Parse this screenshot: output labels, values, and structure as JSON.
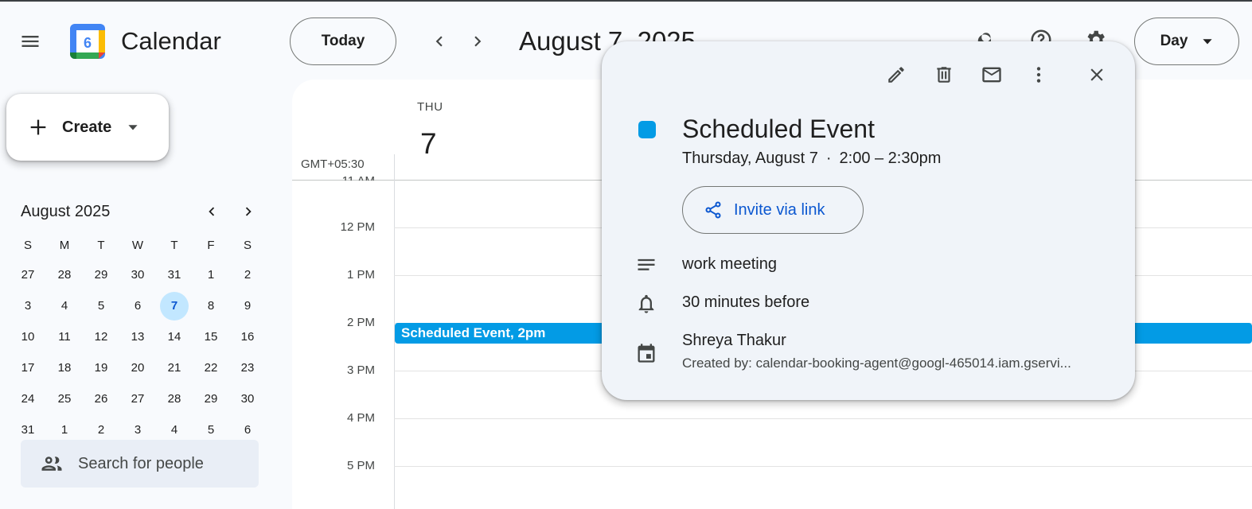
{
  "app": {
    "title": "Calendar",
    "logo_day": "6"
  },
  "header": {
    "today_label": "Today",
    "date_title": "August 7, 2025",
    "view_label": "Day"
  },
  "create": {
    "label": "Create"
  },
  "mini_calendar": {
    "title": "August 2025",
    "dows": [
      "S",
      "M",
      "T",
      "W",
      "T",
      "F",
      "S"
    ],
    "weeks": [
      [
        "27",
        "28",
        "29",
        "30",
        "31",
        "1",
        "2"
      ],
      [
        "3",
        "4",
        "5",
        "6",
        "7",
        "8",
        "9"
      ],
      [
        "10",
        "11",
        "12",
        "13",
        "14",
        "15",
        "16"
      ],
      [
        "17",
        "18",
        "19",
        "20",
        "21",
        "22",
        "23"
      ],
      [
        "24",
        "25",
        "26",
        "27",
        "28",
        "29",
        "30"
      ],
      [
        "31",
        "1",
        "2",
        "3",
        "4",
        "5",
        "6"
      ]
    ],
    "selected": "7"
  },
  "people_search": {
    "placeholder": "Search for people"
  },
  "day_view": {
    "dow": "THU",
    "day": "7",
    "timezone": "GMT+05:30",
    "partial_hour_label": "11 AM",
    "hours": [
      "12 PM",
      "1 PM",
      "2 PM",
      "3 PM",
      "4 PM",
      "5 PM"
    ]
  },
  "event": {
    "title": "Scheduled Event,",
    "time": "2pm"
  },
  "popover": {
    "title": "Scheduled Event",
    "date": "Thursday, August 7",
    "separator": "·",
    "time": "2:00 – 2:30pm",
    "invite_label": "Invite via link",
    "description": "work meeting",
    "reminder": "30 minutes before",
    "calendar_owner": "Shreya Thakur",
    "created_by": "Created by: calendar-booking-agent@googl-465014.iam.gservi..."
  },
  "colors": {
    "event": "#039be5",
    "accent": "#0b57d0",
    "today_highlight": "#c2e7ff",
    "background": "#f8fafd",
    "popover_bg": "#f0f4f9"
  },
  "icons": [
    "menu-icon",
    "search-icon",
    "help-icon",
    "settings-icon",
    "chevron-down-icon",
    "plus-icon",
    "people-icon",
    "edit-icon",
    "delete-icon",
    "email-icon",
    "more-vert-icon",
    "close-icon",
    "share-icon",
    "description-icon",
    "bell-icon",
    "calendar-icon"
  ]
}
